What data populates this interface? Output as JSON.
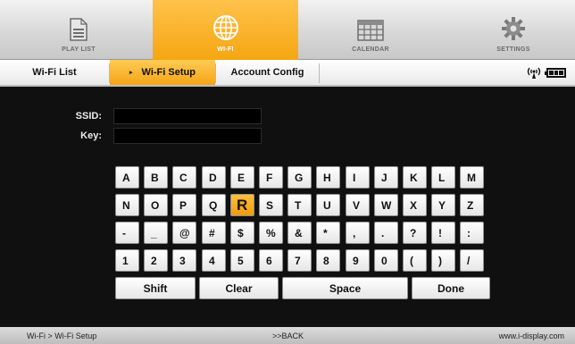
{
  "nav": {
    "tabs": [
      {
        "label": "PLAY LIST",
        "icon": "document-icon"
      },
      {
        "label": "WI-FI",
        "icon": "globe-icon"
      },
      {
        "label": "CALENDAR",
        "icon": "calendar-icon"
      },
      {
        "label": "SETTINGS",
        "icon": "gear-icon"
      }
    ],
    "active_index": 1,
    "active_color": "#f5a612"
  },
  "subtabs": {
    "items": [
      {
        "label": "Wi-Fi List"
      },
      {
        "label": "Wi-Fi Setup"
      },
      {
        "label": "Account Config"
      }
    ],
    "active_index": 1,
    "active_marker": "▸"
  },
  "status": {
    "wifi_icon": "wifi-signal-icon",
    "battery_icon": "battery-icon",
    "battery_level": 1.0
  },
  "form": {
    "ssid_label": "SSID:",
    "ssid_value": "",
    "key_label": "Key:",
    "key_value": ""
  },
  "keyboard": {
    "rows": [
      [
        "A",
        "B",
        "C",
        "D",
        "E",
        "F",
        "G",
        "H",
        "I",
        "J",
        "K",
        "L",
        "M"
      ],
      [
        "N",
        "O",
        "P",
        "Q",
        "R",
        "S",
        "T",
        "U",
        "V",
        "W",
        "X",
        "Y",
        "Z"
      ],
      [
        "-",
        "_",
        "@",
        "#",
        "$",
        "%",
        "&",
        "*",
        ",",
        ".",
        "?",
        "!",
        ":"
      ],
      [
        "1",
        "2",
        "3",
        "4",
        "5",
        "6",
        "7",
        "8",
        "9",
        "0",
        "(",
        ")",
        "/"
      ]
    ],
    "selected_key": "R",
    "function_keys": {
      "shift": "Shift",
      "clear": "Clear",
      "space": "Space",
      "done": "Done"
    }
  },
  "footer": {
    "breadcrumb": "Wi-Fi > Wi-Fi Setup",
    "back": ">>BACK",
    "website": "www.i-display.com"
  }
}
